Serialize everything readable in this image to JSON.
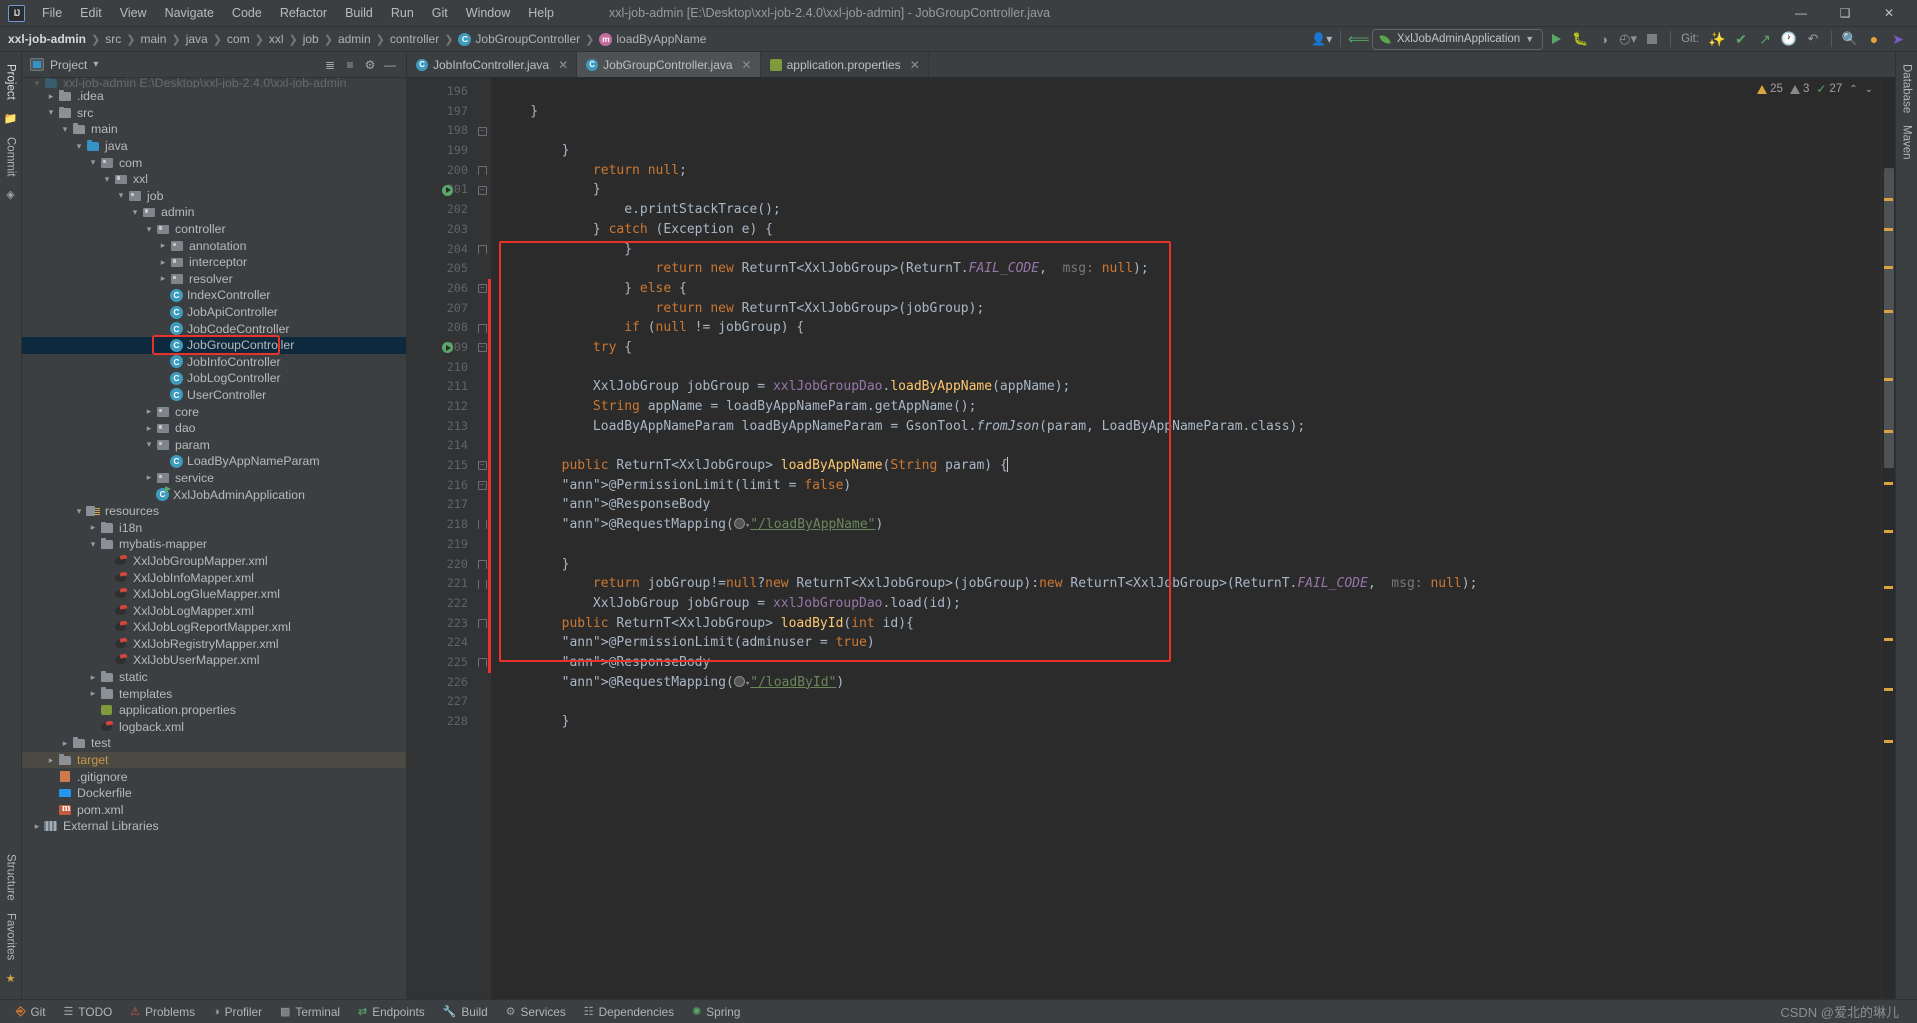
{
  "window": {
    "title": "xxl-job-admin [E:\\Desktop\\xxl-job-2.4.0\\xxl-job-admin] - JobGroupController.java",
    "logo": "IJ",
    "minimize": "—",
    "maximize": "❑",
    "close": "✕"
  },
  "menu": [
    "File",
    "Edit",
    "View",
    "Navigate",
    "Code",
    "Refactor",
    "Build",
    "Run",
    "Git",
    "Window",
    "Help"
  ],
  "breadcrumb": [
    {
      "label": "xxl-job-admin",
      "icon": "",
      "bold": true
    },
    {
      "label": "src",
      "icon": ""
    },
    {
      "label": "main",
      "icon": ""
    },
    {
      "label": "java",
      "icon": ""
    },
    {
      "label": "com",
      "icon": ""
    },
    {
      "label": "xxl",
      "icon": ""
    },
    {
      "label": "job",
      "icon": ""
    },
    {
      "label": "admin",
      "icon": ""
    },
    {
      "label": "controller",
      "icon": ""
    },
    {
      "label": "JobGroupController",
      "icon": "class-icon",
      "badge": "C"
    },
    {
      "label": "loadByAppName",
      "icon": "method-icon",
      "badge": "m"
    }
  ],
  "toolbar": {
    "run_config": "XxlJobAdminApplication",
    "git_label": "Git:",
    "icons": [
      "user-settings-icon",
      "back-arrow-icon",
      "run-icon",
      "debug-icon",
      "coverage-icon",
      "profiler-icon",
      "stop-icon",
      "update-project-icon",
      "commit-icon",
      "push-icon",
      "history-icon",
      "rollback-icon",
      "search-everywhere-icon",
      "notifications-icon",
      "ai-assistant-icon"
    ]
  },
  "project_panel": {
    "title": "Project",
    "dropdown": "▾",
    "collapse_icon": "collapse-all-icon"
  },
  "tree": [
    {
      "label": "xxl-job-admin  E:\\Desktop\\xxl-job-2.4.0\\xxl-job-admin",
      "indent": 0,
      "arrow": "v",
      "icon": "module",
      "cut": true
    },
    {
      "label": ".idea",
      "indent": 1,
      "arrow": ">",
      "icon": "folder"
    },
    {
      "label": "src",
      "indent": 1,
      "arrow": "v",
      "icon": "folder"
    },
    {
      "label": "main",
      "indent": 2,
      "arrow": "v",
      "icon": "folder"
    },
    {
      "label": "java",
      "indent": 3,
      "arrow": "v",
      "icon": "folder-blue"
    },
    {
      "label": "com",
      "indent": 4,
      "arrow": "v",
      "icon": "package"
    },
    {
      "label": "xxl",
      "indent": 5,
      "arrow": "v",
      "icon": "package"
    },
    {
      "label": "job",
      "indent": 6,
      "arrow": "v",
      "icon": "package"
    },
    {
      "label": "admin",
      "indent": 7,
      "arrow": "v",
      "icon": "package"
    },
    {
      "label": "controller",
      "indent": 8,
      "arrow": "v",
      "icon": "package"
    },
    {
      "label": "annotation",
      "indent": 9,
      "arrow": ">",
      "icon": "package"
    },
    {
      "label": "interceptor",
      "indent": 9,
      "arrow": ">",
      "icon": "package"
    },
    {
      "label": "resolver",
      "indent": 9,
      "arrow": ">",
      "icon": "package"
    },
    {
      "label": "IndexController",
      "indent": 9,
      "arrow": "",
      "icon": "class"
    },
    {
      "label": "JobApiController",
      "indent": 9,
      "arrow": "",
      "icon": "class"
    },
    {
      "label": "JobCodeController",
      "indent": 9,
      "arrow": "",
      "icon": "class"
    },
    {
      "label": "JobGroupController",
      "indent": 9,
      "arrow": "",
      "icon": "class",
      "selected": true,
      "boxed": true
    },
    {
      "label": "JobInfoController",
      "indent": 9,
      "arrow": "",
      "icon": "class"
    },
    {
      "label": "JobLogController",
      "indent": 9,
      "arrow": "",
      "icon": "class"
    },
    {
      "label": "UserController",
      "indent": 9,
      "arrow": "",
      "icon": "class"
    },
    {
      "label": "core",
      "indent": 8,
      "arrow": ">",
      "icon": "package"
    },
    {
      "label": "dao",
      "indent": 8,
      "arrow": ">",
      "icon": "package"
    },
    {
      "label": "param",
      "indent": 8,
      "arrow": "v",
      "icon": "package"
    },
    {
      "label": "LoadByAppNameParam",
      "indent": 9,
      "arrow": "",
      "icon": "class"
    },
    {
      "label": "service",
      "indent": 8,
      "arrow": ">",
      "icon": "package"
    },
    {
      "label": "XxlJobAdminApplication",
      "indent": 8,
      "arrow": "",
      "icon": "springboot"
    },
    {
      "label": "resources",
      "indent": 3,
      "arrow": "v",
      "icon": "resources"
    },
    {
      "label": "i18n",
      "indent": 4,
      "arrow": ">",
      "icon": "folder"
    },
    {
      "label": "mybatis-mapper",
      "indent": 4,
      "arrow": "v",
      "icon": "folder"
    },
    {
      "label": "XxlJobGroupMapper.xml",
      "indent": 5,
      "arrow": "",
      "icon": "xml"
    },
    {
      "label": "XxlJobInfoMapper.xml",
      "indent": 5,
      "arrow": "",
      "icon": "xml"
    },
    {
      "label": "XxlJobLogGlueMapper.xml",
      "indent": 5,
      "arrow": "",
      "icon": "xml"
    },
    {
      "label": "XxlJobLogMapper.xml",
      "indent": 5,
      "arrow": "",
      "icon": "xml"
    },
    {
      "label": "XxlJobLogReportMapper.xml",
      "indent": 5,
      "arrow": "",
      "icon": "xml"
    },
    {
      "label": "XxlJobRegistryMapper.xml",
      "indent": 5,
      "arrow": "",
      "icon": "xml"
    },
    {
      "label": "XxlJobUserMapper.xml",
      "indent": 5,
      "arrow": "",
      "icon": "xml"
    },
    {
      "label": "static",
      "indent": 4,
      "arrow": ">",
      "icon": "folder"
    },
    {
      "label": "templates",
      "indent": 4,
      "arrow": ">",
      "icon": "folder"
    },
    {
      "label": "application.properties",
      "indent": 4,
      "arrow": "",
      "icon": "properties"
    },
    {
      "label": "logback.xml",
      "indent": 4,
      "arrow": "",
      "icon": "xml"
    },
    {
      "label": "test",
      "indent": 2,
      "arrow": ">",
      "icon": "folder"
    },
    {
      "label": "target",
      "indent": 1,
      "arrow": ">",
      "icon": "folder",
      "orange": true,
      "rowhl": true
    },
    {
      "label": ".gitignore",
      "indent": 1,
      "arrow": "",
      "icon": "gitignore"
    },
    {
      "label": "Dockerfile",
      "indent": 1,
      "arrow": "",
      "icon": "docker"
    },
    {
      "label": "pom.xml",
      "indent": 1,
      "arrow": "",
      "icon": "maven"
    },
    {
      "label": "External Libraries",
      "indent": 0,
      "arrow": ">",
      "icon": "library"
    }
  ],
  "editor_tabs": [
    {
      "label": "JobInfoController.java",
      "icon": "class-icon",
      "badge": "C",
      "active": false,
      "close": "✕"
    },
    {
      "label": "JobGroupController.java",
      "icon": "class-icon",
      "badge": "C",
      "active": true,
      "close": "✕"
    },
    {
      "label": "application.properties",
      "icon": "properties-icon",
      "badge": "",
      "active": false,
      "close": "✕"
    }
  ],
  "inspection": {
    "warnings": "25",
    "weak_warnings": "3",
    "typos": "27",
    "up_arrow": "⌃",
    "down_arrow": "⌄"
  },
  "left_strip": {
    "project": "Project",
    "commit": "Commit",
    "structure": "Structure",
    "favorites": "Favorites"
  },
  "right_strip": {
    "database": "Database",
    "maven": "Maven"
  },
  "code": {
    "first_line": 196,
    "lines": [
      {
        "n": 196,
        "t": "        }"
      },
      {
        "n": 197,
        "t": ""
      },
      {
        "n": 198,
        "t": "        @RequestMapping(\"/loadById\")",
        "fold": "minus"
      },
      {
        "n": 199,
        "t": "        @ResponseBody"
      },
      {
        "n": 200,
        "t": "        @PermissionLimit(adminuser = true)",
        "fold": "up"
      },
      {
        "n": 201,
        "t": "        public ReturnT<XxlJobGroup> loadById(int id){",
        "run": true,
        "fold": "minus"
      },
      {
        "n": 202,
        "t": "            XxlJobGroup jobGroup = xxlJobGroupDao.load(id);"
      },
      {
        "n": 203,
        "t": "            return jobGroup!=null?new ReturnT<XxlJobGroup>(jobGroup):new ReturnT<XxlJobGroup>(ReturnT.FAIL_CODE,  msg: null);"
      },
      {
        "n": 204,
        "t": "        }",
        "fold": "up"
      },
      {
        "n": 205,
        "t": ""
      },
      {
        "n": 206,
        "t": "        @RequestMapping(\"/loadByAppName\")",
        "fold": "minus"
      },
      {
        "n": 207,
        "t": "        @ResponseBody"
      },
      {
        "n": 208,
        "t": "        @PermissionLimit(limit = false)",
        "fold": "up"
      },
      {
        "n": 209,
        "t": "        public ReturnT<XxlJobGroup> loadByAppName(String param) {",
        "run": true,
        "fold": "minus"
      },
      {
        "n": 210,
        "t": ""
      },
      {
        "n": 211,
        "t": "            LoadByAppNameParam loadByAppNameParam = GsonTool.fromJson(param, LoadByAppNameParam.class);"
      },
      {
        "n": 212,
        "t": "            String appName = loadByAppNameParam.getAppName();"
      },
      {
        "n": 213,
        "t": "            XxlJobGroup jobGroup = xxlJobGroupDao.loadByAppName(appName);"
      },
      {
        "n": 214,
        "t": ""
      },
      {
        "n": 215,
        "t": "            try {",
        "fold": "minus"
      },
      {
        "n": 216,
        "t": "                if (null != jobGroup) {",
        "fold": "minus"
      },
      {
        "n": 217,
        "t": "                    return new ReturnT<XxlJobGroup>(jobGroup);"
      },
      {
        "n": 218,
        "t": "                } else {",
        "fold": "updown"
      },
      {
        "n": 219,
        "t": "                    return new ReturnT<XxlJobGroup>(ReturnT.FAIL_CODE,  msg: null);"
      },
      {
        "n": 220,
        "t": "                }",
        "fold": "up"
      },
      {
        "n": 221,
        "t": "            } catch (Exception e) {",
        "fold": "updown"
      },
      {
        "n": 222,
        "t": "                e.printStackTrace();"
      },
      {
        "n": 223,
        "t": "            }",
        "fold": "up"
      },
      {
        "n": 224,
        "t": "            return null;"
      },
      {
        "n": 225,
        "t": "        }",
        "fold": "up"
      },
      {
        "n": 226,
        "t": ""
      },
      {
        "n": 227,
        "t": "    }"
      },
      {
        "n": 228,
        "t": ""
      }
    ]
  },
  "statusbar": {
    "items": [
      {
        "label": "Git",
        "icon": "git-icon"
      },
      {
        "label": "TODO",
        "icon": "todo-icon"
      },
      {
        "label": "Problems",
        "icon": "problems-icon"
      },
      {
        "label": "Profiler",
        "icon": "profiler-icon"
      },
      {
        "label": "Terminal",
        "icon": "terminal-icon"
      },
      {
        "label": "Endpoints",
        "icon": "endpoints-icon"
      },
      {
        "label": "Build",
        "icon": "build-icon"
      },
      {
        "label": "Services",
        "icon": "services-icon"
      },
      {
        "label": "Dependencies",
        "icon": "dependencies-icon"
      },
      {
        "label": "Spring",
        "icon": "spring-icon"
      }
    ],
    "watermark": "CSDN @爱北的琳儿"
  },
  "colors": {
    "accent_red": "#e8322a",
    "selection_blue": "#0d293e",
    "editor_bg": "#2b2b2b",
    "panel_bg": "#3c3f41",
    "keyword": "#cc7832",
    "annotation": "#bbb529",
    "string": "#6a8759",
    "field": "#9876aa",
    "method": "#ffc66d",
    "text": "#a9b7c6"
  }
}
